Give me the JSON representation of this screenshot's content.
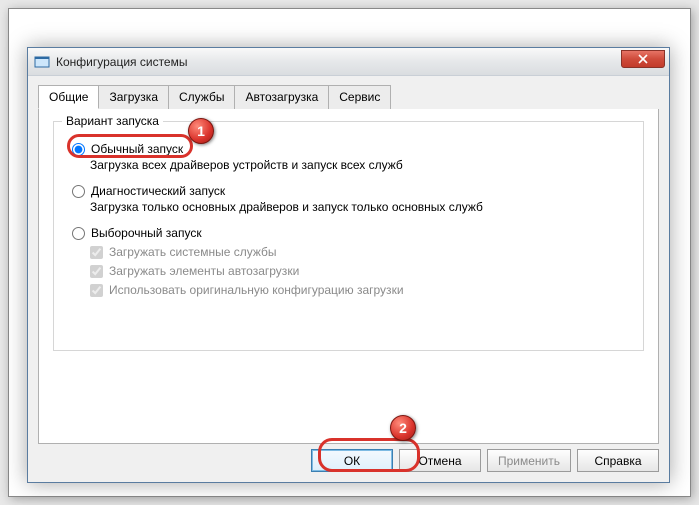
{
  "title": "Конфигурация системы",
  "tabs": [
    "Общие",
    "Загрузка",
    "Службы",
    "Автозагрузка",
    "Сервис"
  ],
  "group_legend": "Вариант запуска",
  "options": {
    "normal": {
      "label": "Обычный запуск",
      "desc": "Загрузка всех драйверов устройств и запуск всех служб"
    },
    "diag": {
      "label": "Диагностический запуск",
      "desc": "Загрузка только основных драйверов и запуск только основных служб"
    },
    "select": {
      "label": "Выборочный запуск"
    }
  },
  "checks": {
    "system_services": "Загружать системные службы",
    "startup_items": "Загружать элементы автозагрузки",
    "original_boot": "Использовать оригинальную конфигурацию загрузки"
  },
  "buttons": {
    "ok": "ОК",
    "cancel": "Отмена",
    "apply": "Применить",
    "help": "Справка"
  },
  "markers": {
    "m1": "1",
    "m2": "2"
  }
}
